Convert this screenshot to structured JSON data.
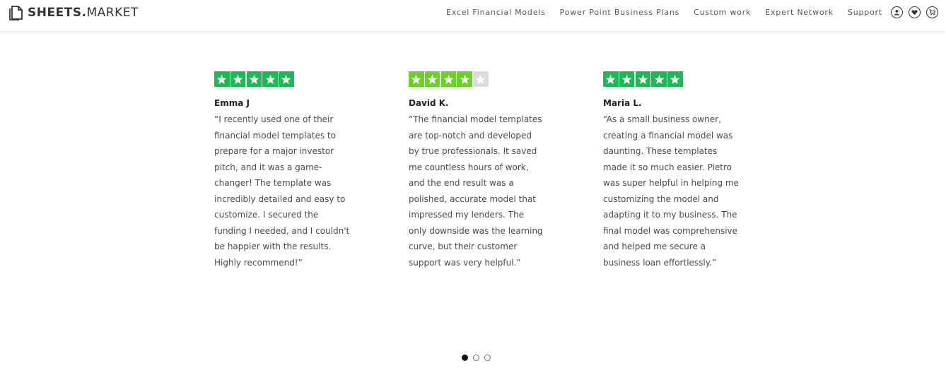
{
  "header": {
    "logo_bold": "SHEETS.",
    "logo_light": "MARKET",
    "nav": [
      "Excel Financial Models",
      "Power Point Business Plans",
      "Custom work",
      "Expert Network",
      "Support"
    ],
    "icons": [
      "user-icon",
      "heart-icon",
      "cart-icon"
    ]
  },
  "reviews": [
    {
      "rating": 5,
      "name": "Emma J",
      "text": "“I recently used one of their financial model templates to prepare for a major investor pitch, and it was a game-changer! The template was incredibly detailed and easy to customize. I secured the funding I needed, and I couldn't be happier with the results. Highly recommend!”"
    },
    {
      "rating": 4,
      "name": "David K.",
      "text": "“The financial model templates are top-notch and developed by true professionals. It saved me countless hours of work, and the end result was a polished, accurate model that impressed my lenders. The only downside was the learning curve, but their customer support was very helpful.”"
    },
    {
      "rating": 5,
      "name": "Maria L.",
      "text": "“As a small business owner, creating a financial model was daunting. These templates made it so much easier. Pietro was super helpful in helping me customizing the model and adapting it to my business. The final model was comprehensive and helped me secure a business loan effortlessly.”"
    }
  ],
  "carousel": {
    "total_slides": 3,
    "active_slide": 1
  },
  "colors": {
    "star_five": "#1db954",
    "star_four": "#6ccf2a",
    "star_empty": "#dcdcdc",
    "star_glyph": "#ffffff"
  }
}
